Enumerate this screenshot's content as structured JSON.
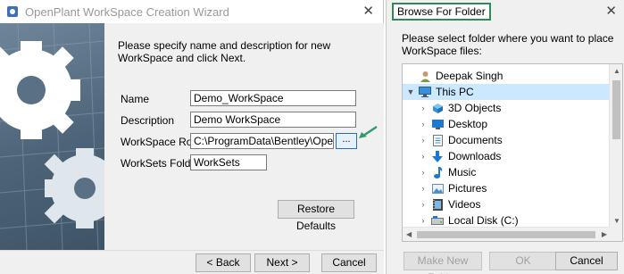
{
  "wizard": {
    "title": "OpenPlant WorkSpace Creation Wizard",
    "close_glyph": "✕",
    "instructions": "Please specify name and description for new WorkSpace and click Next.",
    "fields": {
      "name": {
        "label": "Name",
        "value": "Demo_WorkSpace"
      },
      "description": {
        "label": "Description",
        "value": "Demo WorkSpace"
      },
      "workspace_root": {
        "label": "WorkSpace Root",
        "value": "C:\\ProgramData\\Bentley\\OpenPlant"
      },
      "worksets_folder": {
        "label": "WorkSets Folder",
        "value": "WorkSets"
      }
    },
    "browse_label": "...",
    "restore_defaults": "Restore Defaults",
    "back": "< Back",
    "next": "Next >",
    "cancel": "Cancel"
  },
  "browse_dialog": {
    "title": "Browse For Folder",
    "close_glyph": "✕",
    "instructions": "Please select folder where you want to place WorkSpace files:",
    "tree": [
      {
        "label": "Deepak Singh",
        "icon": "user-icon"
      },
      {
        "label": "This PC",
        "icon": "computer-icon"
      },
      {
        "label": "3D Objects",
        "icon": "3d-objects-icon"
      },
      {
        "label": "Desktop",
        "icon": "desktop-icon"
      },
      {
        "label": "Documents",
        "icon": "documents-icon"
      },
      {
        "label": "Downloads",
        "icon": "downloads-icon"
      },
      {
        "label": "Music",
        "icon": "music-icon"
      },
      {
        "label": "Pictures",
        "icon": "pictures-icon"
      },
      {
        "label": "Videos",
        "icon": "videos-icon"
      },
      {
        "label": "Local Disk (C:)",
        "icon": "disk-icon"
      }
    ],
    "make_new_folder": "Make New Folder",
    "ok": "OK",
    "cancel": "Cancel"
  },
  "colors": {
    "accent_blue": "#2a6bc4",
    "selection": "#cce8ff",
    "highlight_green": "#2e8b57"
  }
}
